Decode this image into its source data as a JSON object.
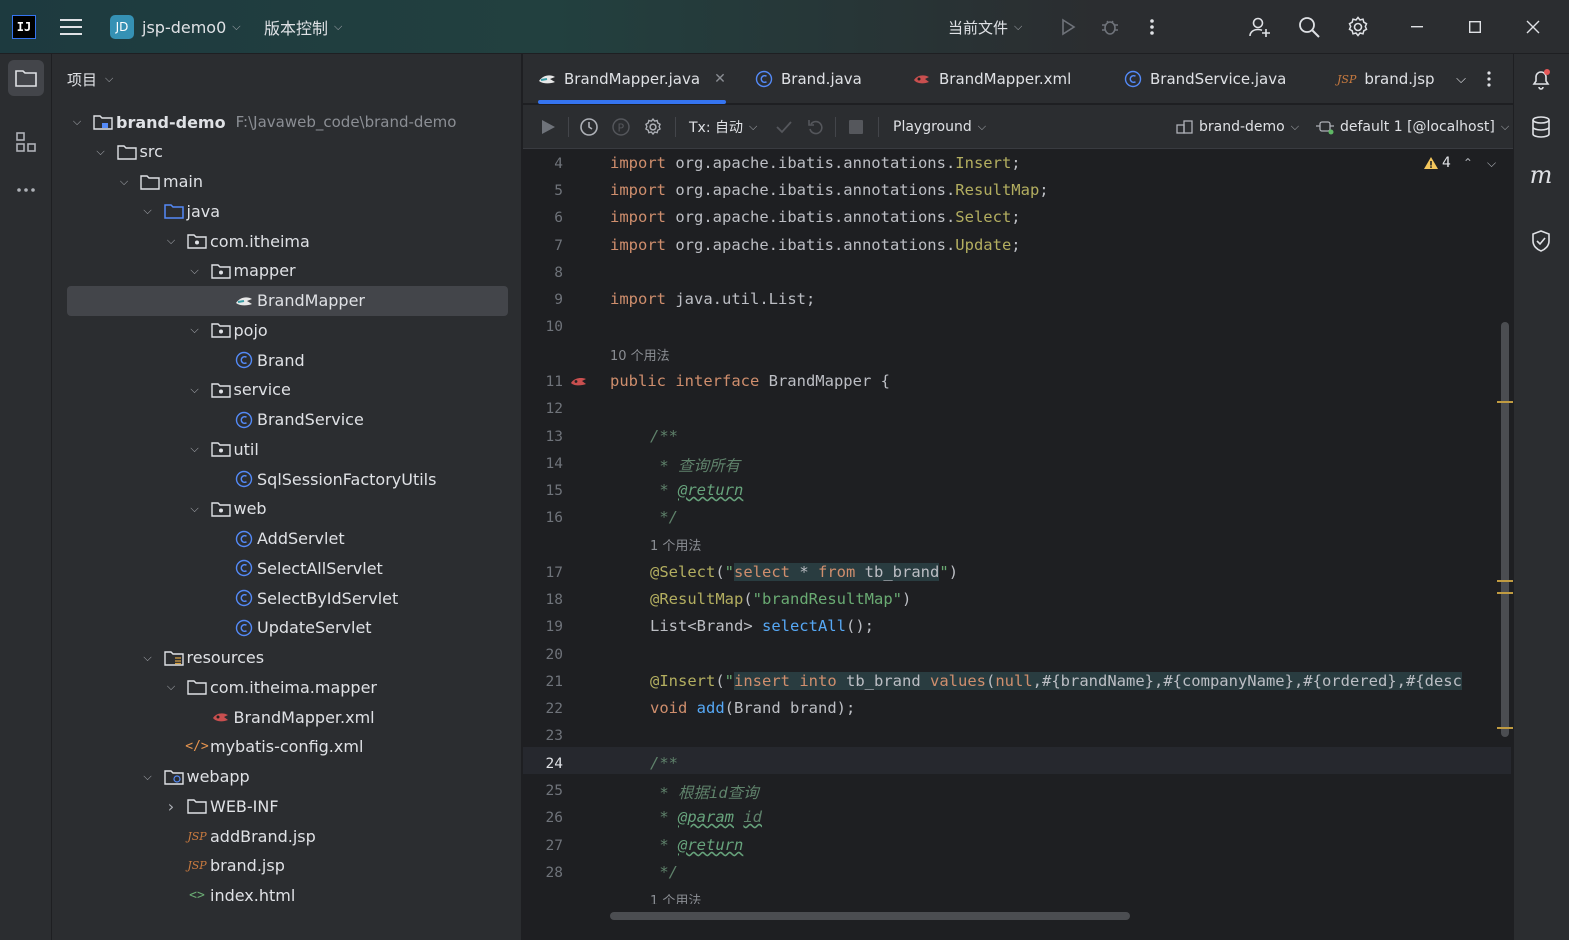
{
  "titlebar": {
    "project_badge": "JD",
    "project_name": "jsp-demo0",
    "vcs_label": "版本控制",
    "current_file_label": "当前文件"
  },
  "project_panel": {
    "title": "项目",
    "tree": [
      {
        "label": "brand-demo",
        "path": "F:\\Javaweb_code\\brand-demo",
        "indent": 0,
        "expanded": true,
        "icon": "module-folder-icon"
      },
      {
        "label": "src",
        "indent": 1,
        "expanded": true,
        "icon": "folder-icon"
      },
      {
        "label": "main",
        "indent": 2,
        "expanded": true,
        "icon": "folder-icon"
      },
      {
        "label": "java",
        "indent": 3,
        "expanded": true,
        "icon": "source-folder-icon"
      },
      {
        "label": "com.itheima",
        "indent": 4,
        "expanded": true,
        "icon": "package-icon"
      },
      {
        "label": "mapper",
        "indent": 5,
        "expanded": true,
        "icon": "package-icon"
      },
      {
        "label": "BrandMapper",
        "indent": 6,
        "icon": "mapper-icon",
        "selected": true
      },
      {
        "label": "pojo",
        "indent": 5,
        "expanded": true,
        "icon": "package-icon"
      },
      {
        "label": "Brand",
        "indent": 6,
        "icon": "class-icon"
      },
      {
        "label": "service",
        "indent": 5,
        "expanded": true,
        "icon": "package-icon"
      },
      {
        "label": "BrandService",
        "indent": 6,
        "icon": "class-icon"
      },
      {
        "label": "util",
        "indent": 5,
        "expanded": true,
        "icon": "package-icon"
      },
      {
        "label": "SqlSessionFactoryUtils",
        "indent": 6,
        "icon": "class-icon"
      },
      {
        "label": "web",
        "indent": 5,
        "expanded": true,
        "icon": "package-icon"
      },
      {
        "label": "AddServlet",
        "indent": 6,
        "icon": "class-icon"
      },
      {
        "label": "SelectAllServlet",
        "indent": 6,
        "icon": "class-icon"
      },
      {
        "label": "SelectByIdServlet",
        "indent": 6,
        "icon": "class-icon"
      },
      {
        "label": "UpdateServlet",
        "indent": 6,
        "icon": "class-icon"
      },
      {
        "label": "resources",
        "indent": 3,
        "expanded": true,
        "icon": "resources-folder-icon"
      },
      {
        "label": "com.itheima.mapper",
        "indent": 4,
        "expanded": true,
        "icon": "folder-icon"
      },
      {
        "label": "BrandMapper.xml",
        "indent": 5,
        "icon": "mybatis-xml-icon"
      },
      {
        "label": "mybatis-config.xml",
        "indent": 4,
        "icon": "xml-icon"
      },
      {
        "label": "webapp",
        "indent": 3,
        "expanded": true,
        "icon": "web-folder-icon"
      },
      {
        "label": "WEB-INF",
        "indent": 4,
        "expanded": false,
        "icon": "folder-icon"
      },
      {
        "label": "addBrand.jsp",
        "indent": 4,
        "icon": "jsp-icon"
      },
      {
        "label": "brand.jsp",
        "indent": 4,
        "icon": "jsp-icon"
      },
      {
        "label": "index.html",
        "indent": 4,
        "icon": "html-icon"
      }
    ]
  },
  "editor": {
    "tabs": [
      {
        "label": "BrandMapper.java",
        "icon": "mapper-icon",
        "active": true
      },
      {
        "label": "Brand.java",
        "icon": "class-icon"
      },
      {
        "label": "BrandMapper.xml",
        "icon": "mybatis-xml-icon"
      },
      {
        "label": "BrandService.java",
        "icon": "class-icon"
      },
      {
        "label": "brand.jsp",
        "icon": "jsp-icon"
      }
    ],
    "toolbar": {
      "tx_label": "Tx: 自动",
      "playground_label": "Playground",
      "datasource_label": "brand-demo",
      "session_label": "default 1 [@localhost]"
    },
    "warnings_count": "4",
    "hints": {
      "usages_10": "10 个用法",
      "usages_1a": "1 个用法",
      "usages_1b": "1 个用法"
    },
    "gutter": [
      "4",
      "5",
      "6",
      "7",
      "8",
      "9",
      "10",
      "11",
      "12",
      "13",
      "14",
      "15",
      "16",
      "17",
      "18",
      "19",
      "20",
      "21",
      "22",
      "23",
      "24",
      "25",
      "26",
      "27",
      "28"
    ]
  },
  "colors": {
    "accent": "#3574f0",
    "keyword": "#cf8e6d",
    "annotation": "#b3ae60",
    "string": "#6aab73",
    "comment": "#5f826b",
    "function": "#56a8f5"
  }
}
